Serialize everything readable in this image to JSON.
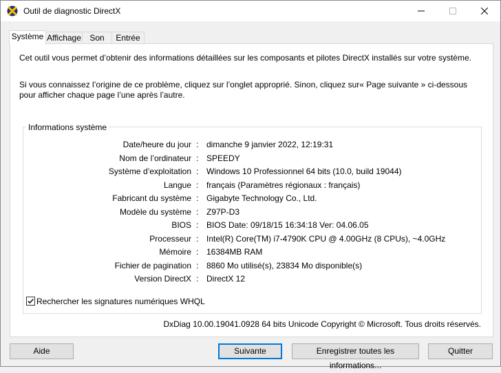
{
  "window": {
    "title": "Outil de diagnostic DirectX"
  },
  "tabs": [
    {
      "label": "Système"
    },
    {
      "label": "Affichage"
    },
    {
      "label": "Son"
    },
    {
      "label": "Entrée"
    }
  ],
  "intro": {
    "line1": "Cet outil vous permet d’obtenir des informations détaillées sur les composants et pilotes DirectX installés sur votre système.",
    "line2": "Si vous connaissez l’origine de ce problème, cliquez sur l’onglet approprié. Sinon, cliquez sur« Page suivante » ci-dessous pour afficher chaque page l’une après l’autre."
  },
  "system_info": {
    "title": "Informations système",
    "rows": [
      {
        "label": "Date/heure du jour",
        "value": "dimanche 9 janvier 2022, 12:19:31"
      },
      {
        "label": "Nom de l’ordinateur",
        "value": "SPEEDY"
      },
      {
        "label": "Système d’exploitation",
        "value": "Windows 10 Professionnel 64 bits (10.0, build 19044)"
      },
      {
        "label": "Langue",
        "value": "français (Paramètres régionaux : français)"
      },
      {
        "label": "Fabricant du système",
        "value": "Gigabyte Technology Co., Ltd."
      },
      {
        "label": "Modèle du système",
        "value": "Z97P-D3"
      },
      {
        "label": "BIOS",
        "value": "BIOS Date: 09/18/15 16:34:18 Ver: 04.06.05"
      },
      {
        "label": "Processeur",
        "value": "Intel(R) Core(TM) i7-4790K CPU @ 4.00GHz (8 CPUs), ~4.0GHz"
      },
      {
        "label": "Mémoire",
        "value": "16384MB RAM"
      },
      {
        "label": "Fichier de pagination",
        "value": "8860 Mo utilisé(s), 23834 Mo disponible(s)"
      },
      {
        "label": "Version DirectX",
        "value": "DirectX 12"
      }
    ],
    "colon": ":"
  },
  "whql": {
    "label": "Rechercher les signatures numériques WHQL",
    "checked": true
  },
  "copyright": "DxDiag 10.00.19041.0928 64 bits Unicode Copyright © Microsoft. Tous droits réservés.",
  "buttons": {
    "help": "Aide",
    "next": "Suivante",
    "save_all": "Enregistrer toutes les informations...",
    "quit": "Quitter"
  },
  "icons": {
    "app": "directx-icon",
    "minimize": "minimize-icon",
    "maximize": "maximize-icon",
    "close": "close-icon",
    "check": "checkmark-icon"
  },
  "colors": {
    "accent": "#0078d7"
  }
}
